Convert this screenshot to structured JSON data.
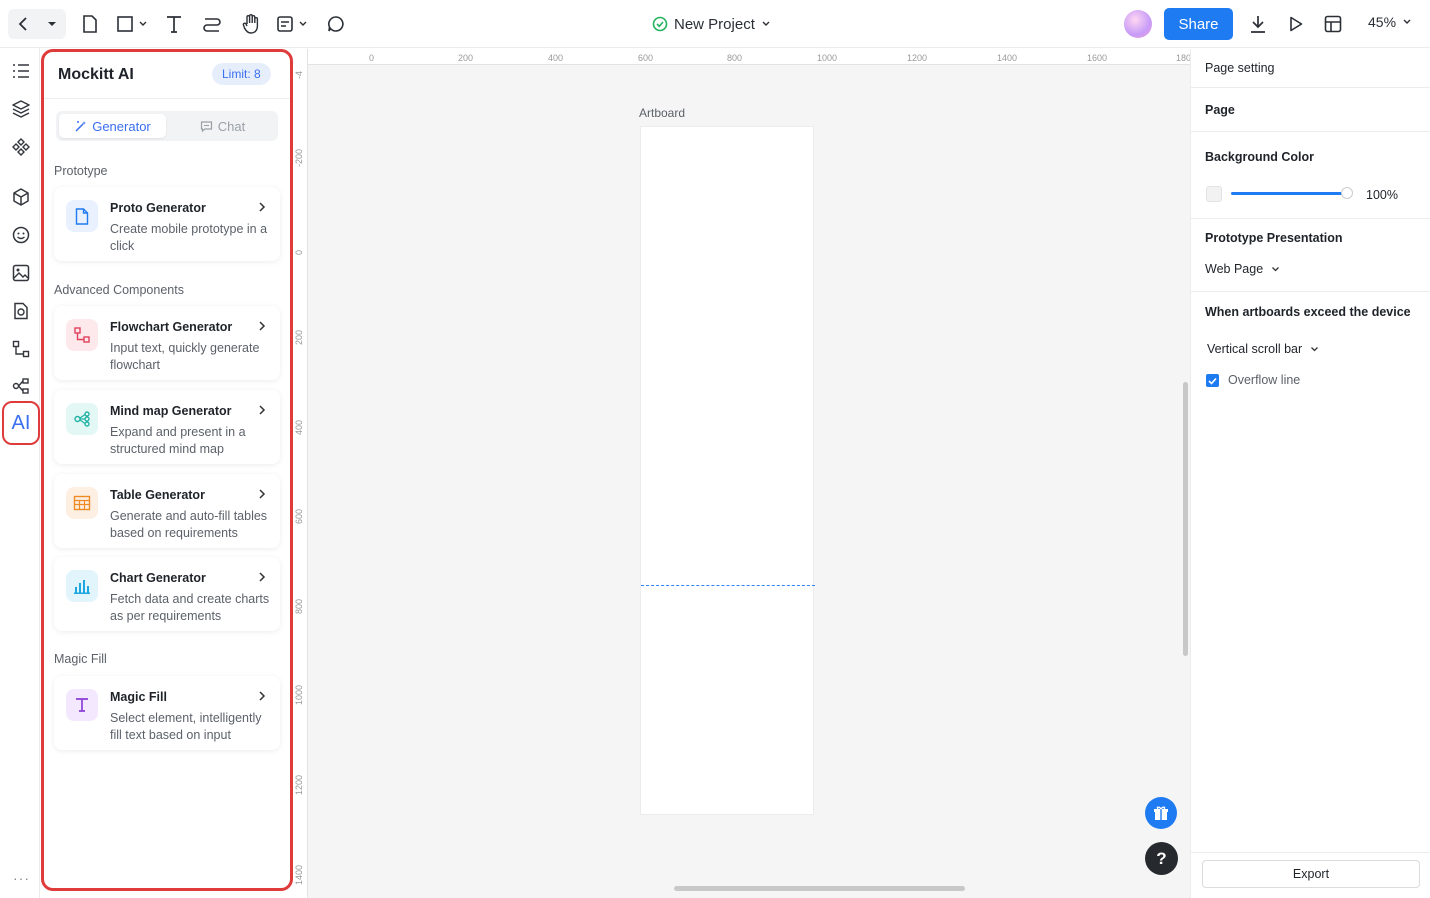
{
  "topbar": {
    "project_name": "New Project",
    "share_label": "Share",
    "zoom": "45%"
  },
  "ai_panel": {
    "title": "Mockitt AI",
    "limit": "Limit: 8",
    "tabs": [
      {
        "label": "Generator",
        "active": true
      },
      {
        "label": "Chat",
        "active": false
      }
    ],
    "sections": [
      {
        "label": "Prototype"
      },
      {
        "label": "Advanced Components"
      },
      {
        "label": "Magic Fill"
      }
    ],
    "cards": [
      {
        "title": "Proto Generator",
        "desc": "Create mobile prototype in a click",
        "icon": "file-icon",
        "icon_bg": "#e8f1fd",
        "icon_color": "#1f7bf2"
      },
      {
        "title": "Flowchart Generator",
        "desc": "Input text, quickly generate flowchart",
        "icon": "flowchart-icon",
        "icon_bg": "#fde8ec",
        "icon_color": "#e0405a"
      },
      {
        "title": "Mind map Generator",
        "desc": "Expand and present in a structured mind map",
        "icon": "mindmap-icon",
        "icon_bg": "#e3f7f5",
        "icon_color": "#22b3a6"
      },
      {
        "title": "Table Generator",
        "desc": "Generate and auto-fill tables based on requirements",
        "icon": "table-icon",
        "icon_bg": "#fdf0e3",
        "icon_color": "#f08a24"
      },
      {
        "title": "Chart Generator",
        "desc": "Fetch data and create charts as per requirements",
        "icon": "bar-chart-icon",
        "icon_bg": "#e3f5fc",
        "icon_color": "#1ea7e0"
      },
      {
        "title": "Magic Fill",
        "desc": "Select element, intelligently fill text based on input",
        "icon": "text-t-icon",
        "icon_bg": "#f3e8fd",
        "icon_color": "#8a3fd6"
      }
    ]
  },
  "canvas": {
    "artboard_label": "Artboard",
    "ruler_top": [
      "0",
      "200",
      "400",
      "600",
      "800",
      "1000",
      "1200",
      "1400",
      "1600",
      "180"
    ],
    "ruler_left": [
      "-4",
      "-200",
      "0",
      "200",
      "400",
      "600",
      "800",
      "1000",
      "1200",
      "1400"
    ],
    "help_label": "?"
  },
  "right_panel": {
    "page_setting": "Page setting",
    "page": "Page",
    "bg_color_label": "Background Color",
    "bg_opacity": "100%",
    "proto_presentation": "Prototype Presentation",
    "proto_mode": "Web Page",
    "exceed_label": "When artboards exceed the device",
    "exceed_mode": "Vertical scroll bar",
    "overflow_label": "Overflow line",
    "export_label": "Export"
  },
  "colors": {
    "accent": "#1f7bf2",
    "highlight_border": "#e03b3b"
  }
}
